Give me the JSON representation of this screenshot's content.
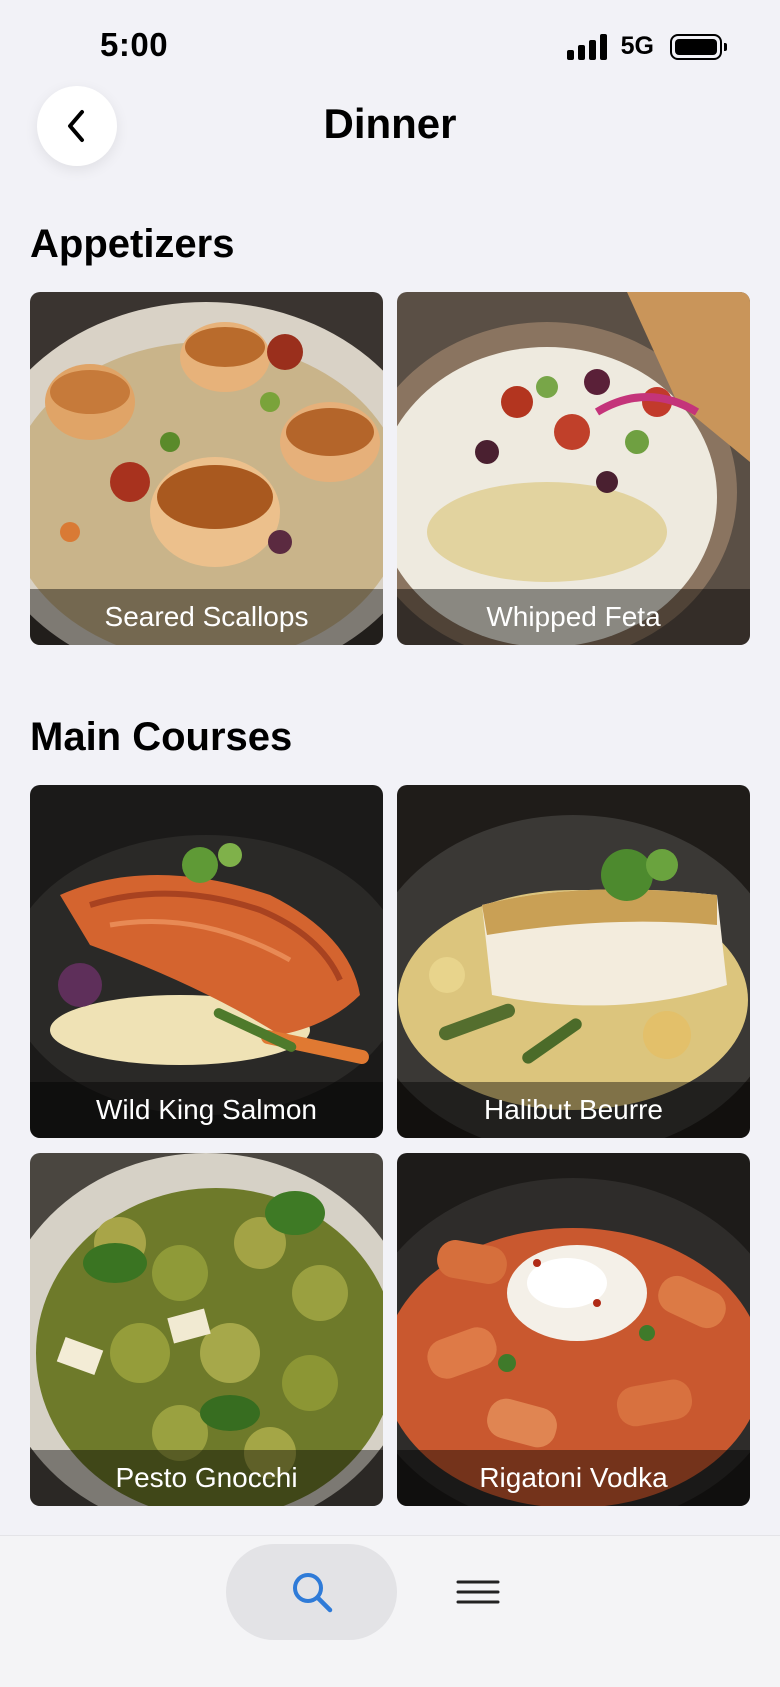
{
  "status_bar": {
    "time": "5:00",
    "network": "5G"
  },
  "header": {
    "title": "Dinner",
    "back_icon": "chevron-left-icon"
  },
  "sections": [
    {
      "title": "Appetizers",
      "items": [
        {
          "label": "Seared Scallops"
        },
        {
          "label": "Whipped Feta"
        }
      ]
    },
    {
      "title": "Main Courses",
      "items": [
        {
          "label": "Wild King Salmon"
        },
        {
          "label": "Halibut Beurre"
        },
        {
          "label": "Pesto Gnocchi"
        },
        {
          "label": "Rigatoni Vodka"
        }
      ]
    }
  ],
  "tab_bar": {
    "items": [
      {
        "icon": "search-icon",
        "selected": true
      },
      {
        "icon": "menu-icon",
        "selected": false
      }
    ]
  },
  "colors": {
    "accent": "#2f7bd8",
    "background": "#f2f2f7"
  }
}
